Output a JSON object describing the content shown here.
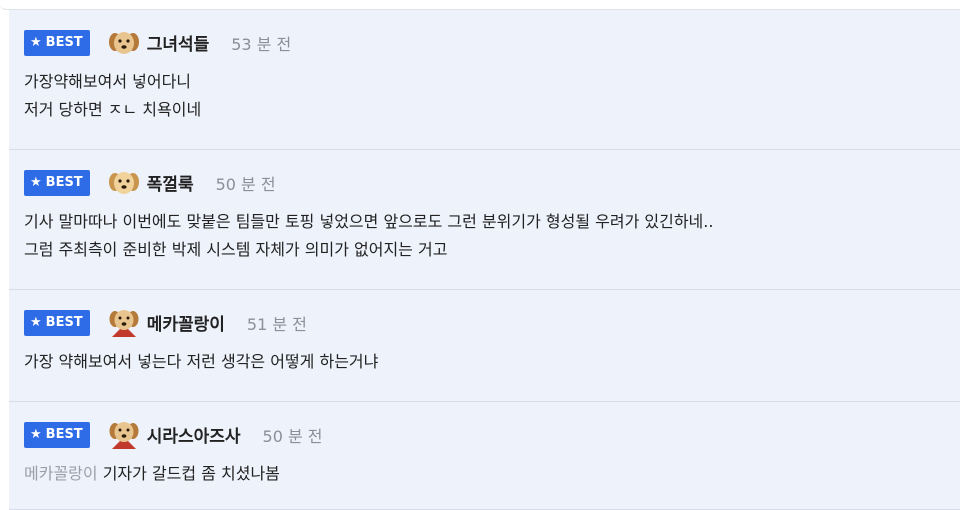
{
  "badge": {
    "label": "BEST",
    "icon": "star-icon"
  },
  "colors": {
    "badge_bg": "#2e6be6",
    "row_bg": "#eef2fb",
    "time": "#8a8f99",
    "mention": "#9aa0aa"
  },
  "comments": [
    {
      "nickname": "그녀석들",
      "time": "53 분 전",
      "avatar": "puppy-avatar",
      "lines": [
        "가장약해보여서 넣어다니",
        "저거 당하면 ㅈㄴ 치욕이네"
      ]
    },
    {
      "nickname": "폭껄룩",
      "time": "50 분 전",
      "avatar": "puppy-avatar",
      "lines": [
        "기사 말마따나 이번에도 맞붙은 팀들만 토핑 넣었으면 앞으로도 그런 분위기가 형성될 우려가 있긴하네..",
        "그럼 주최측이 준비한 박제 시스템 자체가 의미가 없어지는 거고"
      ]
    },
    {
      "nickname": "메카꼴랑이",
      "time": "51 분 전",
      "avatar": "puppy-cape-avatar",
      "lines": [
        "가장 약해보여서 넣는다 저런 생각은 어떻게 하는거냐"
      ]
    },
    {
      "nickname": "시라스아즈사",
      "time": "50 분 전",
      "avatar": "puppy-cape-avatar",
      "mention": "메카꼴랑이",
      "lines": [
        "기자가 갈드컵 좀 치셨나봄"
      ]
    }
  ]
}
